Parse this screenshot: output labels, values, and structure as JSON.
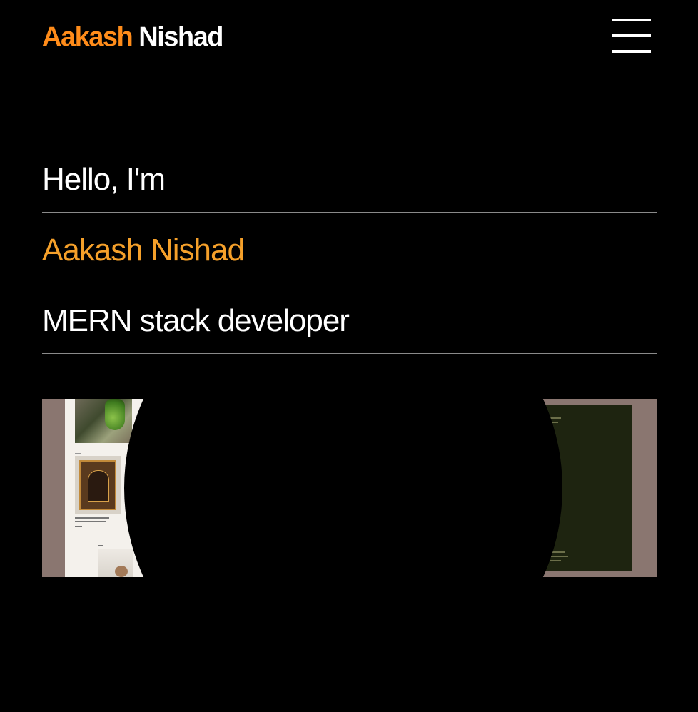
{
  "header": {
    "logo_first": "Aakash",
    "logo_last": "Nishad",
    "menu_icon": "hamburger-menu-icon"
  },
  "hero": {
    "greeting": "Hello, I'm",
    "name": "Aakash Nishad",
    "role": "MERN stack developer"
  },
  "colors": {
    "background": "#000000",
    "accent": "#ff8c1a",
    "name_accent": "#f5a02a",
    "text": "#ffffff",
    "divider": "#8a8a8a"
  }
}
